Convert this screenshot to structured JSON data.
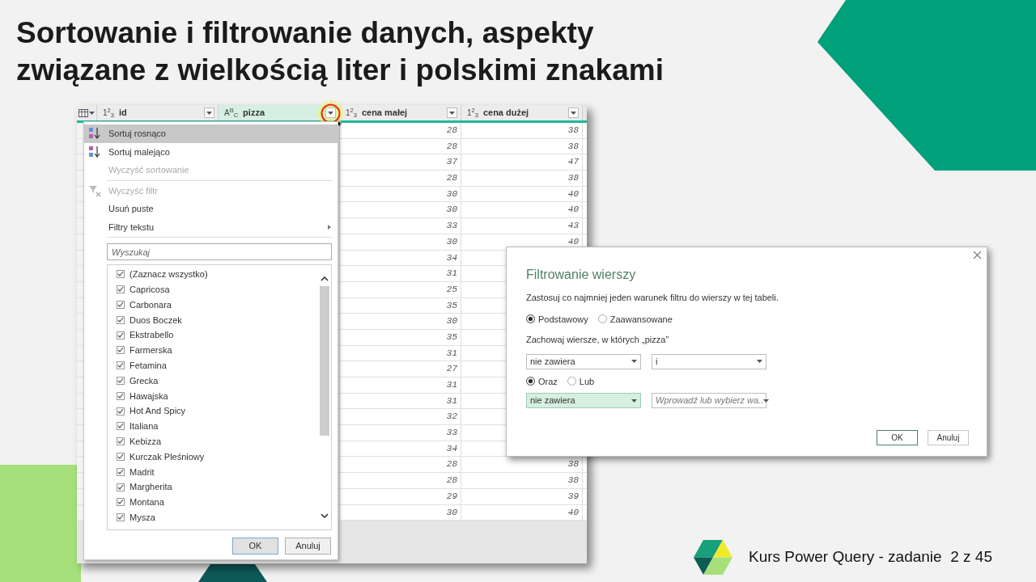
{
  "slide": {
    "title_lines": [
      "Sortowanie i filtrowanie danych, aspekty",
      "związane z wielkością liter i polskimi znakami"
    ],
    "footer": "Kurs Power Query - zadanie  2 z 45"
  },
  "table": {
    "columns": [
      {
        "label": "id",
        "type_label": "1$^{2}$$_{3}$",
        "selected": false
      },
      {
        "label": "pizza",
        "type_label": "A$^{B}$$_{C}$",
        "selected": true
      },
      {
        "label": "cena małej",
        "type_label": "1$^{2}$$_{3}$",
        "selected": false
      },
      {
        "label": "cena dużej",
        "type_label": "1$^{2}$$_{3}$",
        "selected": false
      }
    ],
    "rows": [
      {
        "cena_malej": "28",
        "cena_duzej": "38"
      },
      {
        "cena_malej": "28",
        "cena_duzej": "38"
      },
      {
        "cena_malej": "37",
        "cena_duzej": "47"
      },
      {
        "cena_malej": "28",
        "cena_duzej": "38"
      },
      {
        "cena_malej": "30",
        "cena_duzej": "40"
      },
      {
        "cena_malej": "30",
        "cena_duzej": "40"
      },
      {
        "cena_malej": "33",
        "cena_duzej": "43"
      },
      {
        "cena_malej": "30",
        "cena_duzej": "40"
      },
      {
        "cena_malej": "34"
      },
      {
        "cena_malej": "31"
      },
      {
        "cena_malej": "25"
      },
      {
        "cena_malej": "35"
      },
      {
        "cena_malej": "30"
      },
      {
        "cena_malej": "35"
      },
      {
        "cena_malej": "31"
      },
      {
        "cena_malej": "27"
      },
      {
        "cena_malej": "31"
      },
      {
        "cena_malej": "31"
      },
      {
        "cena_malej": "32"
      },
      {
        "cena_malej": "33"
      },
      {
        "cena_malej": "34"
      },
      {
        "cena_malej": "28",
        "cena_duzej": "38"
      },
      {
        "cena_malej": "28",
        "cena_duzej": "38"
      },
      {
        "cena_malej": "29",
        "cena_duzej": "39"
      },
      {
        "cena_malej": "30",
        "cena_duzej": "40"
      }
    ]
  },
  "sort_menu": {
    "items": [
      {
        "kind": "sort_asc",
        "label": "Sortuj rosnąco",
        "disabled": false,
        "selected": true
      },
      {
        "kind": "sort_desc",
        "label": "Sortuj malejąco",
        "disabled": false,
        "selected": false
      },
      {
        "kind": "plain",
        "label": "Wyczyść sortowanie",
        "disabled": true,
        "selected": false
      },
      {
        "kind": "separator"
      },
      {
        "kind": "clear_filter",
        "label": "Wyczyść filtr",
        "disabled": true,
        "selected": false
      },
      {
        "kind": "plain",
        "label": "Usuń puste",
        "disabled": false,
        "selected": false
      },
      {
        "kind": "submenu",
        "label": "Filtry tekstu",
        "disabled": false,
        "selected": false
      },
      {
        "kind": "separator"
      }
    ],
    "search": {
      "placeholder": "Wyszukaj"
    },
    "values": [
      {
        "label": "(Zaznacz wszystko)",
        "checked": true
      },
      {
        "label": "Capricosa",
        "checked": true
      },
      {
        "label": "Carbonara",
        "checked": true
      },
      {
        "label": "Duos Boczek",
        "checked": true
      },
      {
        "label": "Ekstrabello",
        "checked": true
      },
      {
        "label": "Farmerska",
        "checked": true
      },
      {
        "label": "Fetamina",
        "checked": true
      },
      {
        "label": "Grecka",
        "checked": true
      },
      {
        "label": "Hawajska",
        "checked": true
      },
      {
        "label": "Hot And Spicy",
        "checked": true
      },
      {
        "label": "Italiana",
        "checked": true
      },
      {
        "label": "Kebizza",
        "checked": true
      },
      {
        "label": "Kurczak Pleśniowy",
        "checked": true
      },
      {
        "label": "Madrit",
        "checked": true
      },
      {
        "label": "Margherita",
        "checked": true
      },
      {
        "label": "Montana",
        "checked": true
      },
      {
        "label": "Mysza",
        "checked": true
      }
    ],
    "buttons": [
      {
        "label": "OK",
        "focused": true
      },
      {
        "label": "Anuluj",
        "focused": false
      }
    ]
  },
  "filter_dialog": {
    "title": "Filtrowanie wierszy",
    "description": "Zastosuj co najmniej jeden warunek filtru do wierszy w tej tabeli.",
    "modes": [
      {
        "label": "Podstawowy",
        "selected": true
      },
      {
        "label": "Zaawansowane",
        "selected": false
      }
    ],
    "keep_label": "Zachowaj wiersze, w których „pizza”",
    "condition_1": {
      "operator": "nie zawiera",
      "value": "i",
      "highlighted": false
    },
    "joins": [
      {
        "label": "Oraz",
        "selected": true
      },
      {
        "label": "Lub",
        "selected": false
      }
    ],
    "condition_2": {
      "operator": "nie zawiera",
      "value_placeholder": "Wprowadź lub wybierz wa..",
      "highlighted": true
    },
    "buttons": [
      {
        "label": "OK",
        "focused": true
      },
      {
        "label": "Anuluj",
        "focused": false
      }
    ]
  }
}
